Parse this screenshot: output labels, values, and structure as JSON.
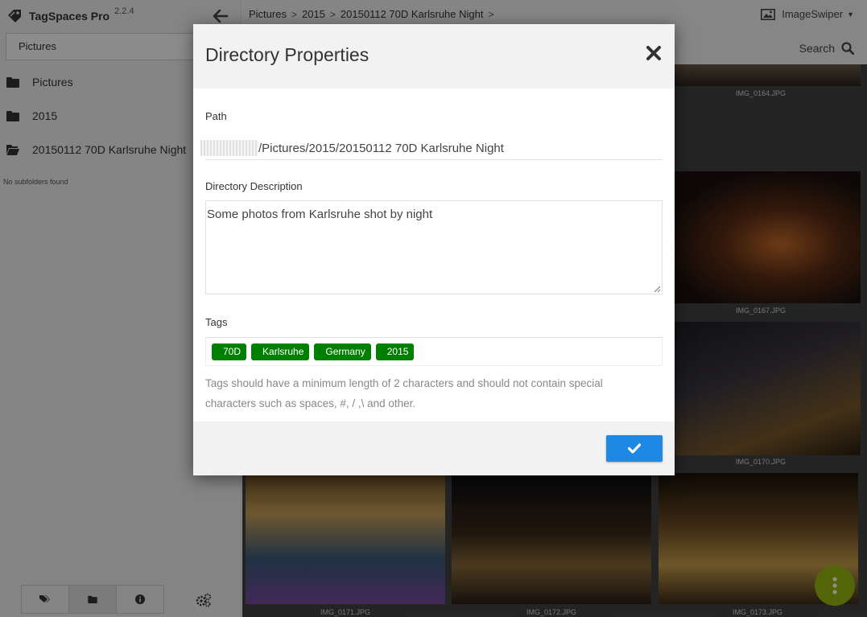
{
  "app": {
    "name": "TagSpaces Pro",
    "version": "2.2.4"
  },
  "sidebar": {
    "location": "Pictures",
    "folders": [
      {
        "name": "Pictures",
        "icon": "folder-icon"
      },
      {
        "name": "2015",
        "icon": "folder-icon"
      },
      {
        "name": "20150112 70D Karlsruhe Night",
        "icon": "folder-open-icon"
      }
    ],
    "no_subfolders": "No subfolders found",
    "tabs": [
      "tag-icon",
      "folder-icon",
      "info-icon"
    ],
    "settings_icon": "gears-icon"
  },
  "breadcrumb": [
    "Pictures",
    "2015",
    "20150112 70D Karlsruhe Night"
  ],
  "perspective": {
    "label": "ImageSwiper",
    "icon": "image-icon"
  },
  "search": {
    "label": "Search"
  },
  "grid": {
    "files": [
      "IMG_0164.JPG",
      "IMG_0167.JPG",
      "IMG_0170.JPG",
      "IMG_0171.JPG",
      "IMG_0172.JPG",
      "IMG_0173.JPG"
    ]
  },
  "dialog": {
    "title": "Directory Properties",
    "path_label": "Path",
    "path_value": "/Pictures/2015/20150112 70D Karlsruhe Night",
    "description_label": "Directory Description",
    "description_value": "Some photos from Karlsruhe shot by night",
    "tags_label": "Tags",
    "tags": [
      "70D",
      "Karlsruhe",
      "Germany",
      "2015"
    ],
    "tags_help": "Tags should have a minimum length of 2 characters and should not contain special characters such as spaces, #, / ,\\ and other."
  },
  "colors": {
    "tag": "#008000",
    "primary": "#1e88e5",
    "fab": "#9ab812"
  }
}
